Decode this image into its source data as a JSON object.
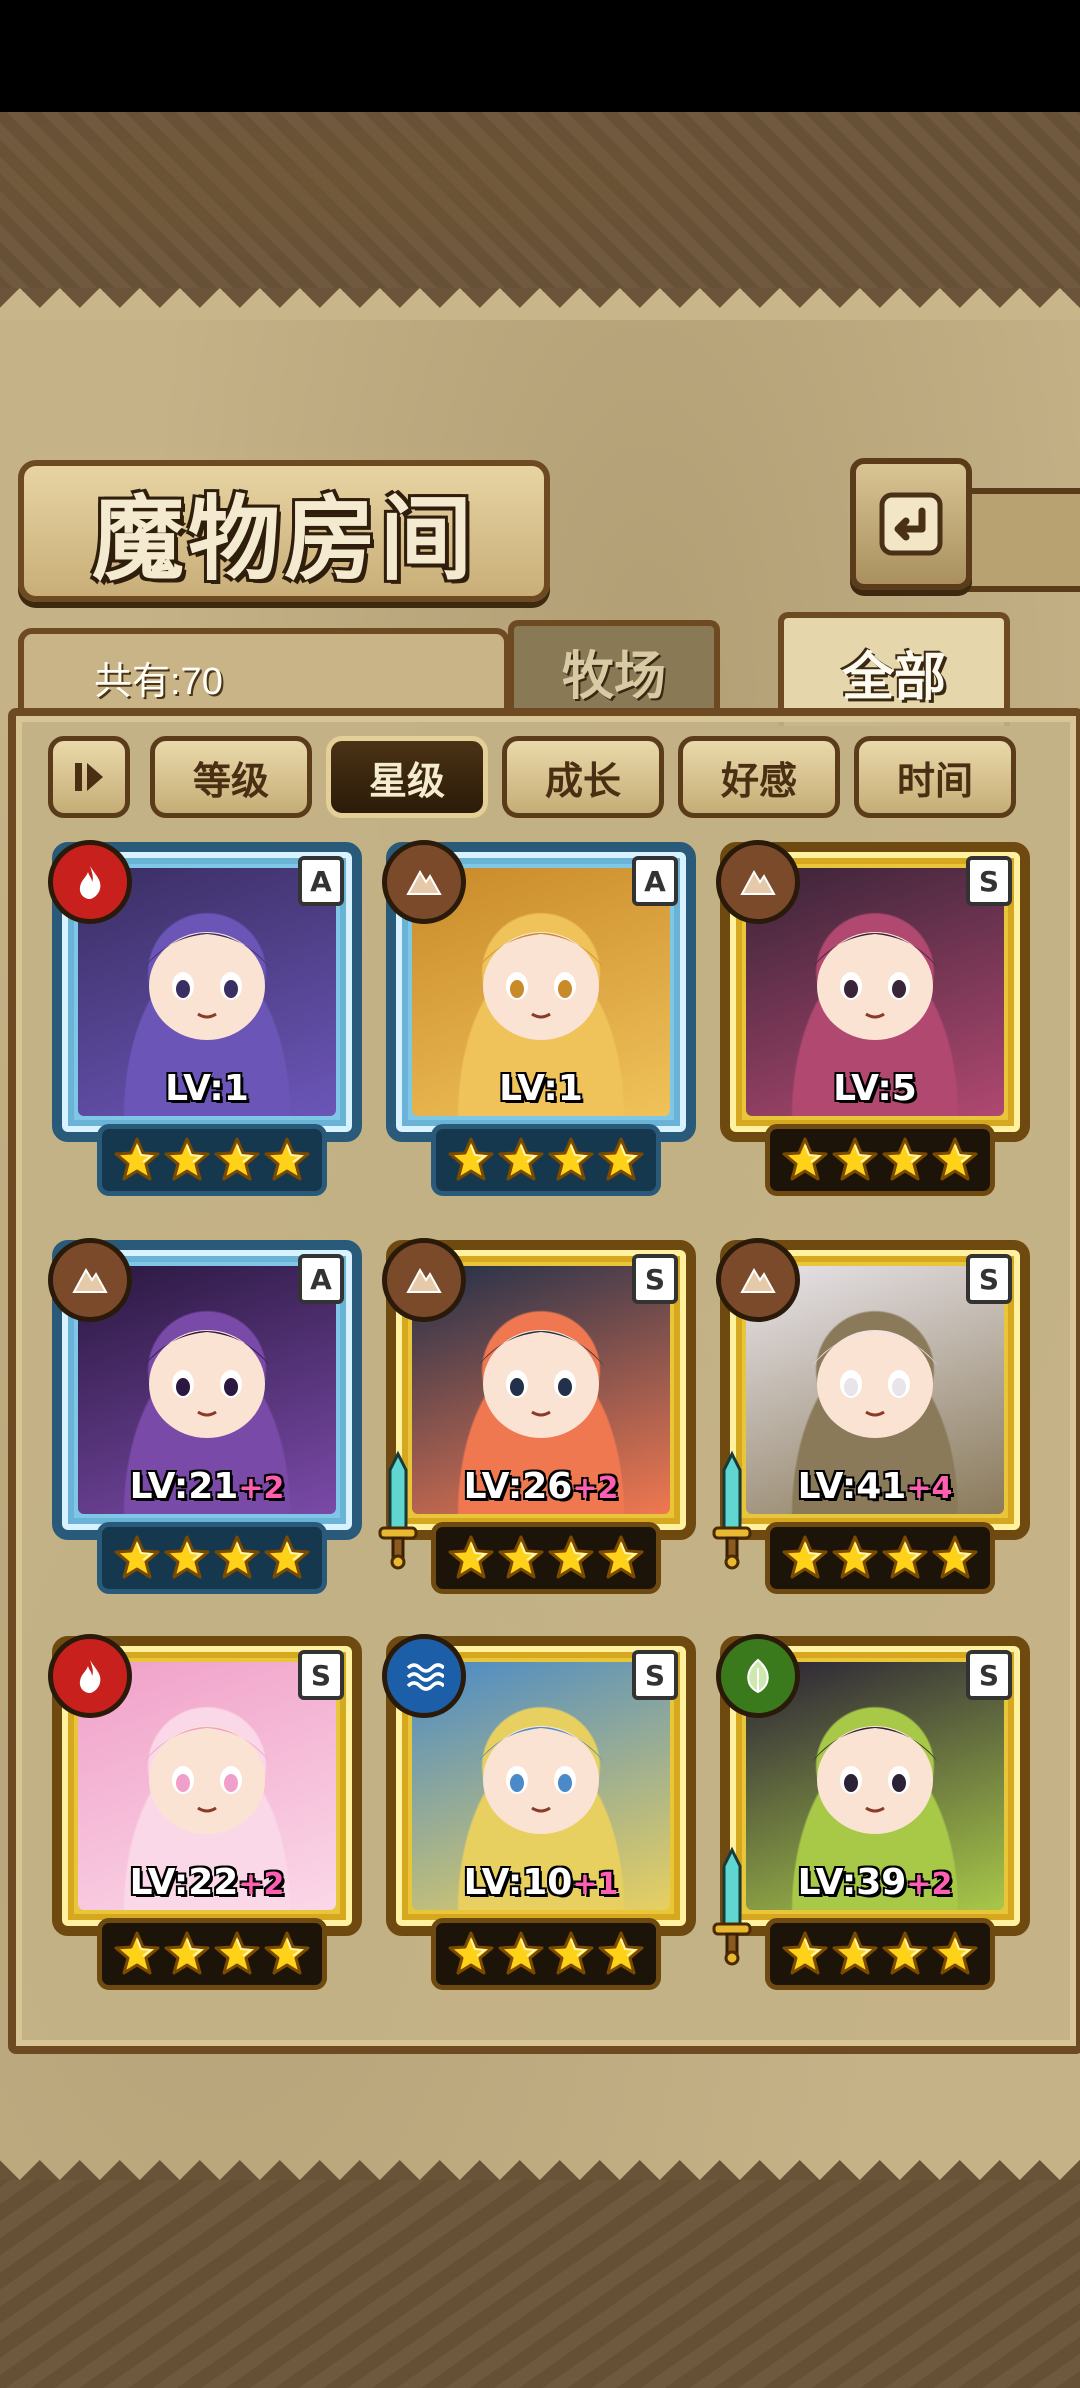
{
  "title": "魔物房间",
  "counter": "共有:70",
  "tabs": {
    "pasture": "牧场",
    "all": "全部"
  },
  "filters": [
    "等级",
    "星级",
    "成长",
    "好感",
    "时间"
  ],
  "active_filter": "星级",
  "colors": {
    "fire": "#c8201c",
    "earth": "#7a4a2a",
    "water": "#1c5fa8",
    "wood": "#3a7a1c"
  },
  "monsters": [
    {
      "rarity": "A",
      "element": "fire",
      "level": "LV:1",
      "bonus": "",
      "stars": 4,
      "sword": false,
      "palette": [
        "#3a2e63",
        "#6b56b8"
      ]
    },
    {
      "rarity": "A",
      "element": "earth",
      "level": "LV:1",
      "bonus": "",
      "stars": 4,
      "sword": false,
      "palette": [
        "#c98a2a",
        "#f0c25a"
      ]
    },
    {
      "rarity": "S",
      "element": "earth",
      "level": "LV:5",
      "bonus": "",
      "stars": 4,
      "sword": false,
      "palette": [
        "#3a2438",
        "#b04870"
      ]
    },
    {
      "rarity": "A",
      "element": "earth",
      "level": "LV:21",
      "bonus": "+2",
      "stars": 4,
      "sword": false,
      "palette": [
        "#2a1840",
        "#7a4aa8"
      ]
    },
    {
      "rarity": "S",
      "element": "earth",
      "level": "LV:26",
      "bonus": "+2",
      "stars": 4,
      "sword": true,
      "palette": [
        "#22304a",
        "#f07850"
      ]
    },
    {
      "rarity": "S",
      "element": "earth",
      "level": "LV:41",
      "bonus": "+4",
      "stars": 4,
      "sword": true,
      "palette": [
        "#e8e4ea",
        "#8a7a5a"
      ]
    },
    {
      "rarity": "S",
      "element": "fire",
      "level": "LV:22",
      "bonus": "+2",
      "stars": 4,
      "sword": false,
      "palette": [
        "#f0a0c8",
        "#fbd8e8"
      ]
    },
    {
      "rarity": "S",
      "element": "water",
      "level": "LV:10",
      "bonus": "+1",
      "stars": 4,
      "sword": false,
      "palette": [
        "#4a8ac8",
        "#e8d060"
      ]
    },
    {
      "rarity": "S",
      "element": "wood",
      "level": "LV:39",
      "bonus": "+2",
      "stars": 4,
      "sword": true,
      "palette": [
        "#2a2236",
        "#a8c848"
      ]
    }
  ]
}
